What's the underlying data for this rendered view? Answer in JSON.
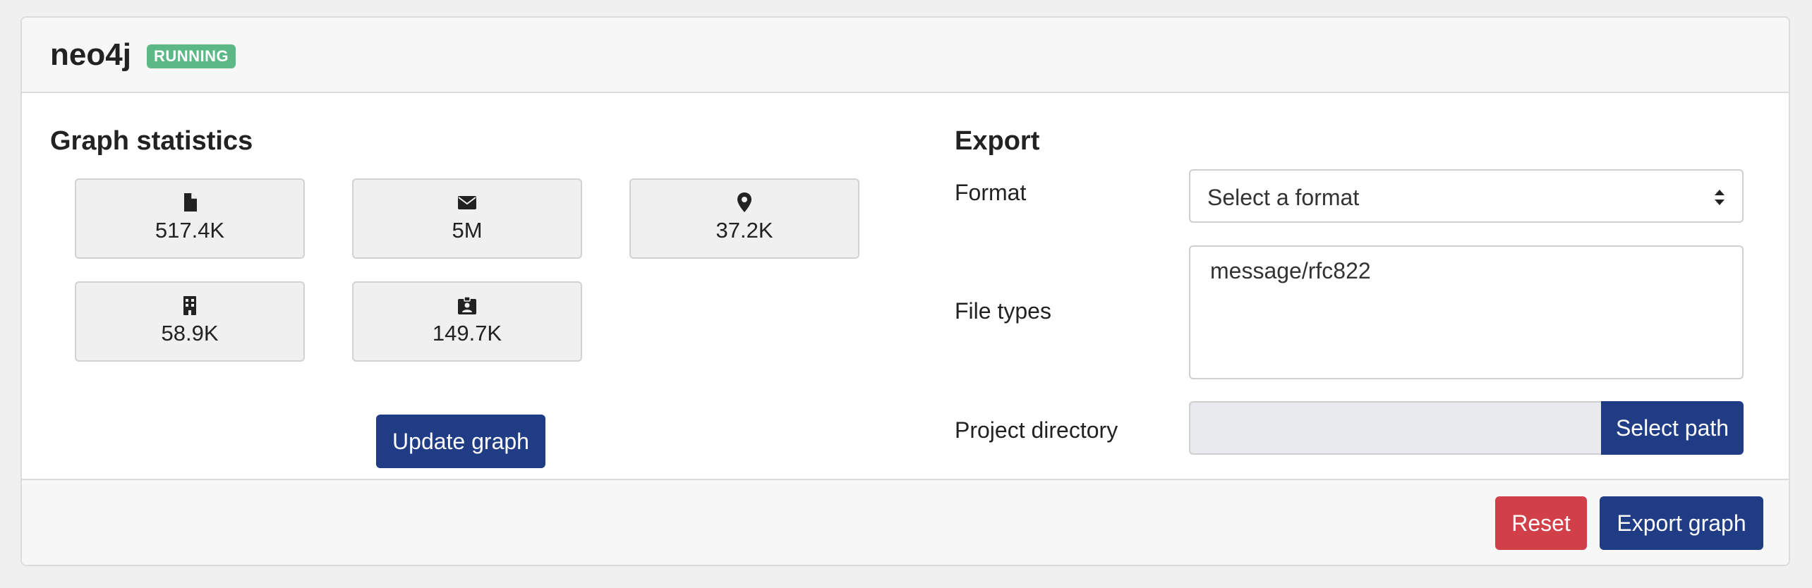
{
  "header": {
    "title": "neo4j",
    "status": "RUNNING"
  },
  "stats": {
    "title": "Graph statistics",
    "tiles": [
      {
        "icon": "file-icon",
        "value": "517.4K"
      },
      {
        "icon": "envelope-icon",
        "value": "5M"
      },
      {
        "icon": "map-marker-icon",
        "value": "37.2K"
      },
      {
        "icon": "building-icon",
        "value": "58.9K"
      },
      {
        "icon": "id-badge-icon",
        "value": "149.7K"
      }
    ],
    "update_button": "Update graph"
  },
  "export": {
    "title": "Export",
    "format_label": "Format",
    "format_placeholder": "Select a format",
    "file_types_label": "File types",
    "file_types_value": "message/rfc822",
    "project_dir_label": "Project directory",
    "select_path_button": "Select path"
  },
  "footer": {
    "reset_button": "Reset",
    "export_button": "Export graph"
  },
  "colors": {
    "primary": "#203c84",
    "danger": "#d13f48",
    "success": "#5cb987"
  }
}
